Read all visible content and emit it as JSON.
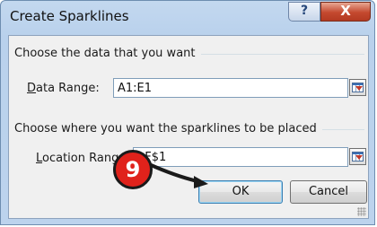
{
  "dialog": {
    "title": "Create Sparklines",
    "help_label": "?",
    "close_label": "X"
  },
  "data_section": {
    "heading": "Choose the data that you want",
    "range_label_mnemonic": "D",
    "range_label_rest": "ata Range:",
    "range_value": "A1:E1"
  },
  "location_section": {
    "heading": "Choose where you want the sparklines to be placed",
    "range_label_mnemonic": "L",
    "range_label_rest": "ocation Range:",
    "range_value": "$F$1"
  },
  "buttons": {
    "ok_label": "OK",
    "cancel_label": "Cancel"
  },
  "callout": {
    "step_number": "9"
  },
  "colors": {
    "badge_red": "#e0221b",
    "title_bar": "#b9d1ec",
    "close_red": "#c4492f"
  }
}
